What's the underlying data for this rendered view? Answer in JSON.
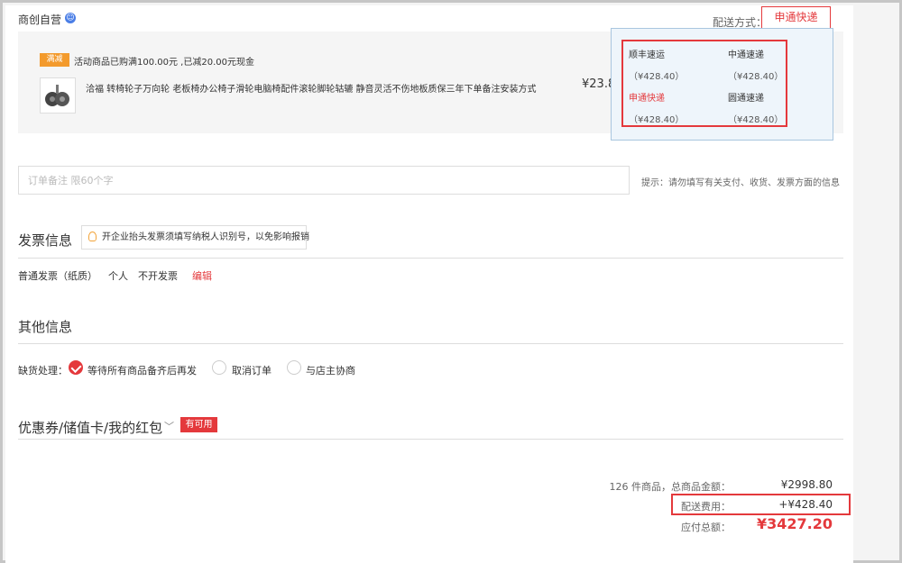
{
  "shop": {
    "name": "商创自营"
  },
  "shipping": {
    "label": "配送方式：",
    "selected": "申通快递",
    "options": [
      {
        "name": "顺丰速运",
        "price": "（¥428.40）"
      },
      {
        "name": "中通速递",
        "price": "（¥428.40）"
      },
      {
        "name": "申通快递",
        "price": "（¥428.40）"
      },
      {
        "name": "圆通速递",
        "price": "（¥428.40）"
      }
    ]
  },
  "product": {
    "promo_badge": "满减",
    "promo_text": "活动商品已购满100.00元 ,已减20.00元现金",
    "name": "洽福 转椅轮子万向轮 老板椅办公椅子滑轮电脑椅配件滚轮脚轮轱辘 静音灵活不伤地板质保三年下单备注安装方式",
    "price": "¥23.8"
  },
  "remark": {
    "placeholder": "订单备注 限60个字",
    "hint": "提示：请勿填写有关支付、收货、发票方面的信息"
  },
  "invoice": {
    "title": "发票信息",
    "tip": "开企业抬头发票须填写纳税人识别号，以免影响报销",
    "type": "普通发票（纸质）",
    "person": "个人",
    "content": "不开发票",
    "edit": "编辑"
  },
  "other": {
    "title": "其他信息",
    "shortage_label": "缺货处理：",
    "options": [
      "等待所有商品备齐后再发",
      "取消订单",
      "与店主协商"
    ]
  },
  "coupon": {
    "title": "优惠券/储值卡/我的红包",
    "badge": "有可用"
  },
  "summary": {
    "items_label": "126 件商品，总商品金额：",
    "items_value": "¥2998.80",
    "fee_label": "配送费用：",
    "fee_value": "+¥428.40",
    "total_label": "应付总额：",
    "total_value": "¥3427.20"
  }
}
